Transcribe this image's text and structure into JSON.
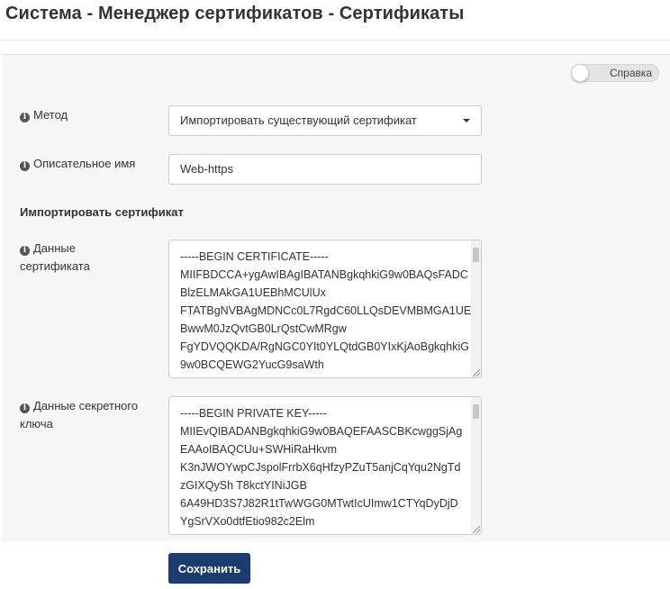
{
  "page": {
    "title": "Система - Менеджер сертификатов - Сертификаты"
  },
  "help_toggle": {
    "label": "Справка",
    "state": "off"
  },
  "form": {
    "method": {
      "label": "Метод",
      "icon": "info-icon",
      "selected": "Импортировать существующий сертификат"
    },
    "description": {
      "label": "Описательное имя",
      "icon": "info-icon",
      "value": "Web-https"
    },
    "import_section": {
      "heading": "Импортировать сертификат"
    },
    "cert_data": {
      "label_line1": "Данные",
      "label_line2": "сертификата",
      "icon": "info-icon",
      "lines": [
        "-----BEGIN CERTIFICATE-----",
        "MIIFBDCCA+ygAwIBAgIBATANBgkqhkiG9w0BAQsFADC",
        "BlzELMAkGA1UEBhMCUlUx",
        "FTATBgNVBAgMDNCc0L7RgdC60LLQsDEVMBMGA1UE",
        "BwwM0JzQvtGB0LrQstCwMRgw",
        "FgYDVQQKDA/RgNGC0YIt0YLQtdGB0YIxKjAoBgkqhkiG",
        "9w0BCQEWG2YucG9saWth"
      ]
    },
    "key_data": {
      "label_line1": "Данные секретного",
      "label_line2": "ключа",
      "icon": "info-icon",
      "lines": [
        "-----BEGIN PRIVATE KEY-----",
        "MIIEvQIBADANBgkqhkiG9w0BAQEFAASCBKcwggSjAg",
        "EAAoIBAQCUu+SWHiRaHkvm",
        "K3nJWOYwpCJspolFrrbX6qHfzyPZuT5anjCqYqu2NgTd",
        "zGIXQySh T8kctYINiJGB",
        "6A49HD3S7J82R1tTwWGG0MTwtIcUImw1CTYqDyDjD",
        "YgSrVXo0dtfEtio982c2Elm"
      ]
    },
    "save_label": "Сохранить"
  },
  "colors": {
    "primary_button": "#1b3c6e",
    "panel_background": "#f7f7f7"
  }
}
